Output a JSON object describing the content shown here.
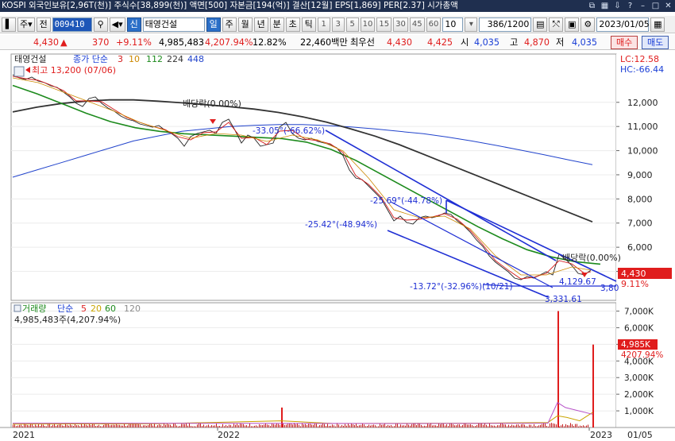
{
  "topbar": {
    "info_text": "KOSPI  외국인보유[2,96T(천)]  주식수[38,899(천)]  액면[500]  자본금[194(억)]  결산[12월]  EPS[1,869]  PER[2.37]  시가총액"
  },
  "toolbar": {
    "menu_glyph": "▌",
    "mode_label": "주",
    "mode_caret": "▾",
    "prev_label": "전",
    "code": "009410",
    "search_glyph": "⚲",
    "sound_glyph": "◀",
    "sound_caret": "▾",
    "badge": "신",
    "stock_name": "태영건설",
    "period_day": "일",
    "period_week": "주",
    "period_month": "월",
    "period_year": "년",
    "period_minute": "분",
    "period_second": "초",
    "period_tick": "틱",
    "intervals": [
      "1",
      "3",
      "5",
      "10",
      "15",
      "30",
      "45",
      "60"
    ],
    "interval_selected": "10",
    "interval_caret": "▾",
    "count_display": "386/1200",
    "date": "2023/01/05"
  },
  "quote": {
    "price": "4,430",
    "arrow": "▲",
    "change": "370",
    "change_pct": "+9.11%",
    "volume": "4,985,483",
    "volume_ratio": "4,207.94%",
    "turnover": "12.82%",
    "amount": "22,460백만",
    "best_ask_label": "최우선",
    "best_ask": "4,430",
    "best_bid": "4,425",
    "open_label": "시",
    "open": "4,035",
    "high_label": "고",
    "high": "4,870",
    "low_label": "저",
    "low": "4,035",
    "buy_label": "매수",
    "sell_label": "매도"
  },
  "chart_data": [
    {
      "type": "line",
      "title": "태영건설",
      "indicator_label": "종가 단순",
      "ma_periods": [
        "3",
        "10",
        "112",
        "224",
        "448"
      ],
      "ma_colors": [
        "#d41b1b",
        "#cc8800",
        "#1c8a1c",
        "#333333",
        "#2244cc"
      ],
      "x_tick_labels": [
        "2021",
        "2022",
        "2023",
        "01/05"
      ],
      "y_ticks": [
        5000,
        6000,
        7000,
        8000,
        9000,
        10000,
        11000,
        12000
      ],
      "y_tick_labels": [
        "5,000",
        "6,000",
        "7,000",
        "8,000",
        "9,000",
        "10,000",
        "11,000",
        "12,000"
      ],
      "ylim": [
        3800,
        14000
      ],
      "lc_label": "LC:12.58",
      "hc_label": "HC:-66.44",
      "last_price_label": "4,430",
      "last_change_label": "9.11%",
      "annotations": {
        "high": "최고 13,200 (07/06)",
        "dividend_1": "배당락(0.00%)",
        "dividend_2": "배당락(0.00%)",
        "channel_1": "-33.05°(-66.62%)",
        "channel_2": "-25.69°(-44.78%)",
        "channel_3": "-25.42°(-48.94%)",
        "low_mark": "-13.72°(-32.96%)(10/21)",
        "value_1": "4,129.67",
        "value_2": "3,331.61",
        "value_3": "3,80"
      },
      "series": [
        {
          "name": "종가",
          "x": [
            "2021-01",
            "2021-02",
            "2021-03",
            "2021-04",
            "2021-05",
            "2021-06",
            "2021-07",
            "2021-08",
            "2021-09",
            "2021-10",
            "2021-11",
            "2021-12",
            "2022-01",
            "2022-02",
            "2022-03",
            "2022-04",
            "2022-05",
            "2022-06",
            "2022-07",
            "2022-08",
            "2022-09",
            "2022-10",
            "2022-11",
            "2022-12",
            "2023-01"
          ],
          "values": [
            12600,
            12800,
            12300,
            11700,
            11300,
            10900,
            10300,
            10500,
            10900,
            10200,
            10500,
            10700,
            10000,
            8700,
            6900,
            7100,
            7000,
            6600,
            5800,
            4900,
            4300,
            3950,
            4100,
            4300,
            4430
          ]
        },
        {
          "name": "448",
          "values": [
            8900,
            9200,
            9500,
            9800,
            10100,
            10400,
            10600,
            10800,
            10900,
            11000,
            11050,
            11080,
            11080,
            11040,
            10980,
            10900,
            10800,
            10700,
            10560,
            10400,
            10220,
            10030,
            9830,
            9620,
            9420
          ]
        },
        {
          "name": "224",
          "values": [
            11600,
            11800,
            11950,
            12050,
            12100,
            12100,
            12050,
            11980,
            11900,
            11820,
            11720,
            11580,
            11400,
            11180,
            10900,
            10600,
            10250,
            9850,
            9450,
            9050,
            8650,
            8250,
            7850,
            7450,
            7050
          ]
        },
        {
          "name": "112",
          "values": [
            12700,
            12350,
            11950,
            11550,
            11200,
            10950,
            10800,
            10700,
            10650,
            10600,
            10550,
            10500,
            10350,
            10050,
            9600,
            9050,
            8500,
            7950,
            7400,
            6850,
            6350,
            5900,
            5600,
            5400,
            5300
          ]
        }
      ]
    },
    {
      "type": "bar",
      "title": "거래량",
      "indicator_label": "단순",
      "ma_periods": [
        "5",
        "20",
        "60",
        "120"
      ],
      "ma_colors": [
        "#dd2222",
        "#c9a400",
        "#1c8a1c",
        "#8a8a8a"
      ],
      "summary": "4,985,483주(4,207.94%)",
      "y_ticks": [
        1000,
        2000,
        3000,
        4000,
        5000,
        6000,
        7000
      ],
      "y_tick_labels": [
        "1,000K",
        "2,000K",
        "3,000K",
        "4,000K",
        "5,000K",
        "6,000K",
        "7,000K"
      ],
      "ylim": [
        0,
        7500
      ],
      "last_volume_label": "4,985K",
      "last_ratio_label": "4207.94%",
      "spikes": [
        {
          "x": "2022-03",
          "value": 1200
        },
        {
          "x": "2022-12",
          "value": 7000
        },
        {
          "x": "2023-01-05",
          "value": 4985
        }
      ]
    }
  ]
}
